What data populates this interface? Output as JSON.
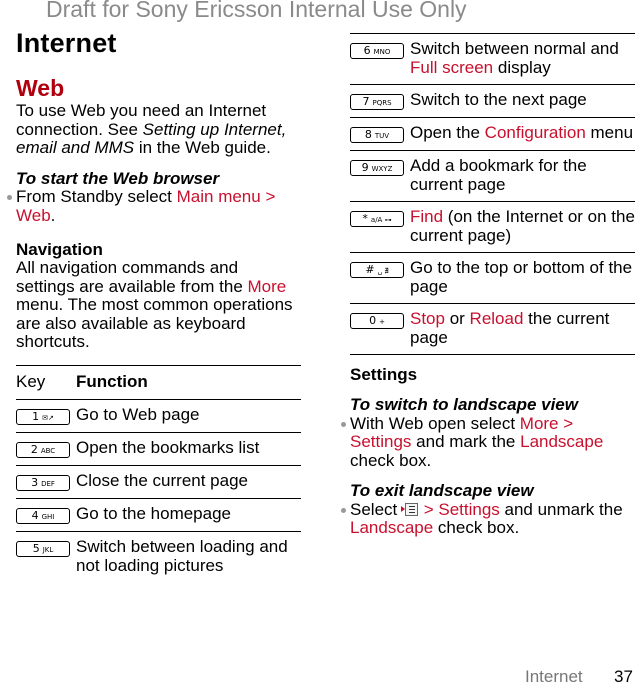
{
  "watermark": "Draft for Sony Ericsson Internal Use Only",
  "page_title": "Internet",
  "section_title": "Web",
  "intro": {
    "part1": "To use Web you need an Internet connection. See ",
    "link": "Setting up Internet, email and MMS",
    "part2": " in the Web guide."
  },
  "start_browser": {
    "heading": "To start the Web browser",
    "step_prefix": "From Standby select ",
    "step_menu": "Main menu > Web",
    "step_suffix": "."
  },
  "navigation": {
    "heading": "Navigation",
    "part1": "All navigation commands and settings are available from the ",
    "more": "More",
    "part2": " menu. The most common operations are also available as keyboard shortcuts."
  },
  "table": {
    "col_key": "Key",
    "col_function": "Function",
    "rows_left": [
      {
        "key_num": "1",
        "key_letters": "✉↗",
        "function": "Go to Web page"
      },
      {
        "key_num": "2",
        "key_letters": "ABC",
        "function": "Open the bookmarks list"
      },
      {
        "key_num": "3",
        "key_letters": "DEF",
        "function": "Close the current page"
      },
      {
        "key_num": "4",
        "key_letters": "GHI",
        "function": "Go to the homepage"
      },
      {
        "key_num": "5",
        "key_letters": "JKL",
        "function": "Switch between loading and not loading pictures"
      }
    ],
    "rows_right": [
      {
        "key_num": "6",
        "key_letters": "MNO",
        "fn_pre": "Switch between normal and ",
        "fn_red": "Full screen",
        "fn_post": " display"
      },
      {
        "key_num": "7",
        "key_letters": "PQRS",
        "fn_pre": "Switch to the next page",
        "fn_red": "",
        "fn_post": ""
      },
      {
        "key_num": "8",
        "key_letters": "TUV",
        "fn_pre": "Open the ",
        "fn_red": "Configuration",
        "fn_post": " menu"
      },
      {
        "key_num": "9",
        "key_letters": "WXYZ",
        "fn_pre": "Add a bookmark for the current page",
        "fn_red": "",
        "fn_post": ""
      },
      {
        "key_num": "*",
        "key_letters": "a/A ⊶",
        "fn_pre": "",
        "fn_red": "Find",
        "fn_post": " (on the Internet or on the current page)"
      },
      {
        "key_num": "#",
        "key_letters": "␣ ∄",
        "fn_pre": "Go to the top or bottom of the page",
        "fn_red": "",
        "fn_post": ""
      },
      {
        "key_num": "0",
        "key_letters": "+",
        "fn_pre": "",
        "fn_red": "Stop",
        "fn_mid": " or ",
        "fn_red2": "Reload",
        "fn_post": " the current page"
      }
    ]
  },
  "settings": {
    "heading": "Settings",
    "landscape_on": {
      "heading": "To switch to landscape view",
      "pre": "With Web open select ",
      "menu1": "More > Settings",
      "mid": " and mark the ",
      "menu2": "Landscape",
      "post": " check box."
    },
    "landscape_off": {
      "heading": "To exit landscape view",
      "pre": "Select ",
      "icon": "menu-icon",
      "menu1": " > Settings",
      "mid": " and unmark the ",
      "menu2": "Landscape",
      "post": " check box."
    }
  },
  "footer": {
    "section": "Internet",
    "page_number": "37"
  },
  "colors": {
    "heading_red": "#b0000e",
    "menu_red": "#c8102e",
    "watermark_gray": "#8a8a8a"
  }
}
